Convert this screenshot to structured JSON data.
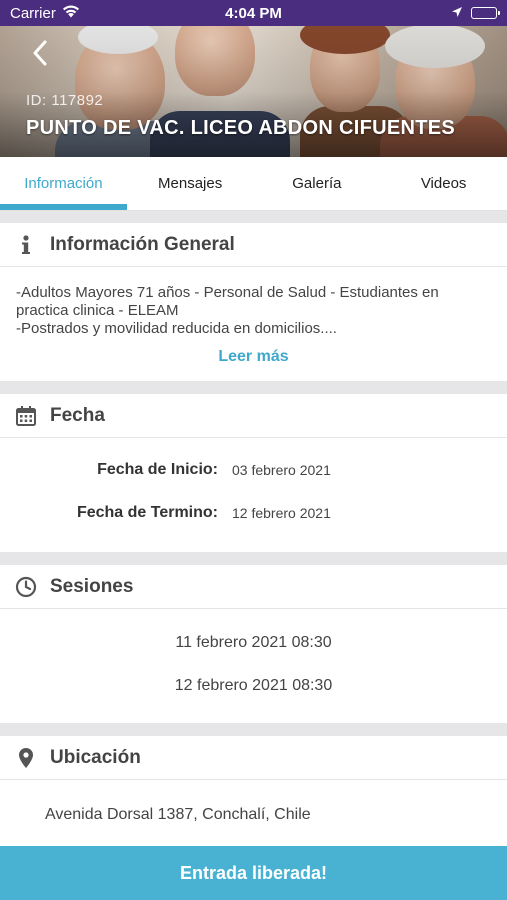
{
  "status_bar": {
    "carrier": "Carrier",
    "time": "4:04 PM"
  },
  "event": {
    "id": "ID: 117892",
    "title": "PUNTO DE VAC. LICEO ABDON CIFUENTES"
  },
  "tabs": [
    {
      "label": "Información",
      "active": true
    },
    {
      "label": "Mensajes",
      "active": false
    },
    {
      "label": "Galería",
      "active": false
    },
    {
      "label": "Videos",
      "active": false
    }
  ],
  "general": {
    "title": "Información General",
    "description": "-Adultos Mayores 71 años - Personal de Salud - Estudiantes en practica clinica - ELEAM\n-Postrados y movilidad reducida en domicilios....",
    "read_more": "Leer más"
  },
  "dates": {
    "title": "Fecha",
    "start_label": "Fecha de Inicio:",
    "start_value": "03 febrero 2021",
    "end_label": "Fecha de Termino:",
    "end_value": "12 febrero 2021"
  },
  "sessions": {
    "title": "Sesiones",
    "items": [
      "11 febrero 2021 08:30",
      "12 febrero 2021 08:30"
    ]
  },
  "location": {
    "title": "Ubicación",
    "address": "Avenida Dorsal 1387, Conchalí, Chile"
  },
  "footer": {
    "label": "Entrada liberada!"
  },
  "colors": {
    "accent": "#3ea9cc",
    "footer": "#49b2d2",
    "status_bar": "#4a2d7e"
  }
}
